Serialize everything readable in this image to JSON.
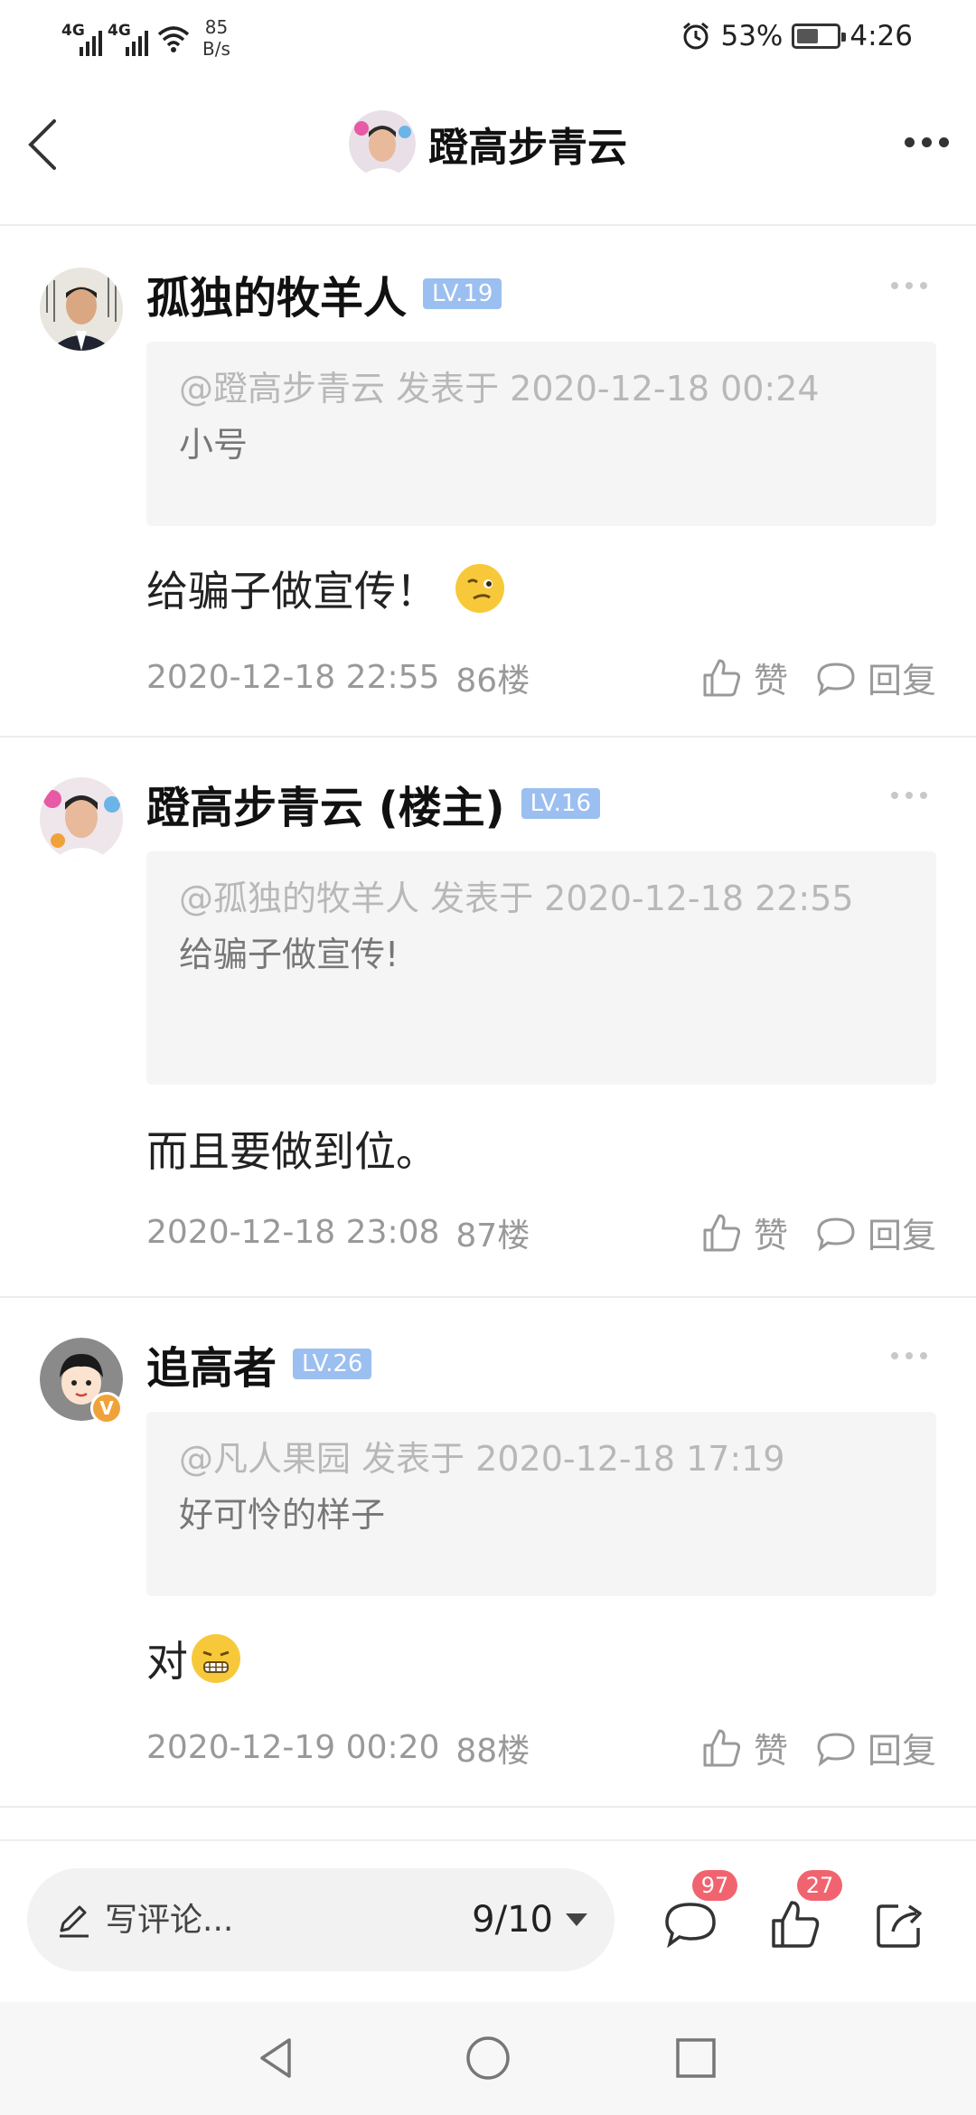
{
  "status_bar": {
    "network_1": "4G",
    "network_2": "4G",
    "speed_value": "85",
    "speed_unit": "B/s",
    "battery": "53%",
    "battery_level": 0.53,
    "time": "4:26"
  },
  "header": {
    "title": "蹬高步青云"
  },
  "comments": [
    {
      "name": "孤独的牧羊人",
      "level": "LV.19",
      "quote_meta": "@蹬高步青云 发表于 2020-12-18 00:24",
      "quote_text": "小号",
      "text": "给骗子做宣传！",
      "emoji": "wink-face-icon",
      "time": "2020-12-18 22:55",
      "floor": "86楼",
      "like_label": "赞",
      "reply_label": "回复"
    },
    {
      "name": "蹬高步青云 (楼主)",
      "level": "LV.16",
      "quote_meta": "@孤独的牧羊人 发表于 2020-12-18 22:55",
      "quote_text": "给骗子做宣传!",
      "text": "而且要做到位。",
      "time": "2020-12-18 23:08",
      "floor": "87楼",
      "like_label": "赞",
      "reply_label": "回复"
    },
    {
      "name": "追高者",
      "level": "LV.26",
      "verified_badge": "V",
      "quote_meta": "@凡人果园 发表于 2020-12-18 17:19",
      "quote_text": "好可怜的样子",
      "text": "对",
      "emoji": "grimace-face-icon",
      "time": "2020-12-19 00:20",
      "floor": "88楼",
      "like_label": "赞",
      "reply_label": "回复"
    }
  ],
  "bottom_bar": {
    "comment_placeholder": "写评论...",
    "page_indicator": "9/10",
    "comment_count": "97",
    "like_count": "27"
  },
  "colors": {
    "level_badge": "#9bbff0",
    "count_badge": "#f06470",
    "verified": "#f0a23a"
  }
}
